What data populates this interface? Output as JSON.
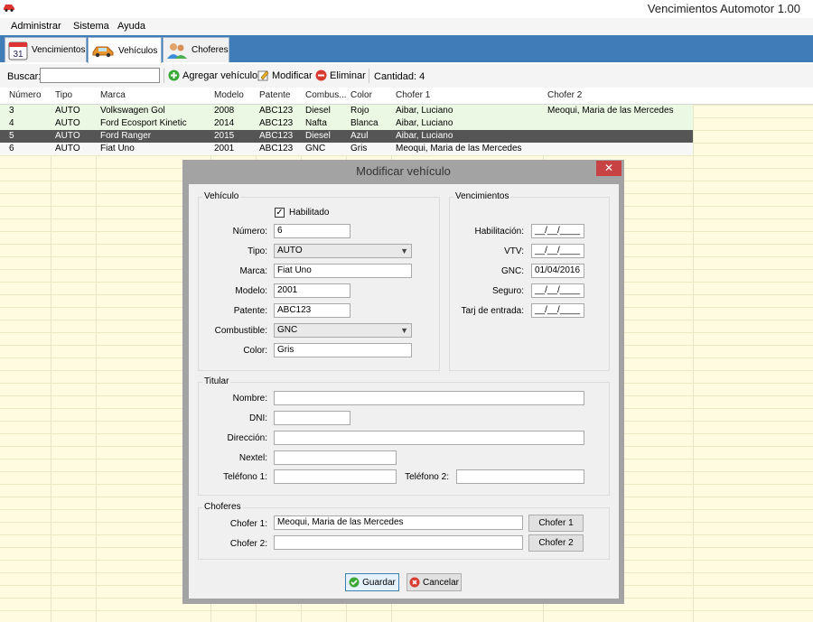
{
  "window": {
    "title": "Vencimientos Automotor 1.00"
  },
  "menu": [
    "Administrar",
    "Sistema",
    "Ayuda"
  ],
  "tabs": [
    {
      "label": "Vencimientos",
      "icon": "calendar-icon",
      "badge": "31"
    },
    {
      "label": "Vehículos",
      "icon": "car-icon"
    },
    {
      "label": "Choferes",
      "icon": "users-icon"
    }
  ],
  "toolbar": {
    "search_label": "Buscar:",
    "search_value": "",
    "add_label": "Agregar vehículo",
    "edit_label": "Modificar",
    "delete_label": "Eliminar",
    "count_label": "Cantidad: 4"
  },
  "grid": {
    "columns": [
      "Número",
      "Tipo",
      "Marca",
      "Modelo",
      "Patente",
      "Combus...",
      "Color",
      "Chofer 1",
      "Chofer 2"
    ],
    "rows": [
      [
        "3",
        "AUTO",
        "Volkswagen Gol",
        "2008",
        "ABC123",
        "Diesel",
        "Rojo",
        "Aibar, Luciano",
        "Meoqui, Maria de las Mercedes"
      ],
      [
        "4",
        "AUTO",
        "Ford Ecosport Kinetic",
        "2014",
        "ABC123",
        "Nafta",
        "Blanca",
        "Aibar, Luciano",
        ""
      ],
      [
        "5",
        "AUTO",
        "Ford Ranger",
        "2015",
        "ABC123",
        "Diesel",
        "Azul",
        "Aibar, Luciano",
        ""
      ],
      [
        "6",
        "AUTO",
        "Fiat Uno",
        "2001",
        "ABC123",
        "GNC",
        "Gris",
        "Meoqui, Maria de las Mercedes",
        ""
      ]
    ],
    "selected_row": 2
  },
  "dialog": {
    "title": "Modificar vehículo",
    "close": "✕",
    "vehiculo": {
      "title": "Vehículo",
      "habilitado_label": "Habilitado",
      "habilitado": true,
      "numero_label": "Número:",
      "numero": "6",
      "tipo_label": "Tipo:",
      "tipo": "AUTO",
      "marca_label": "Marca:",
      "marca": "Fiat Uno",
      "modelo_label": "Modelo:",
      "modelo": "2001",
      "patente_label": "Patente:",
      "patente": "ABC123",
      "combustible_label": "Combustible:",
      "combustible": "GNC",
      "color_label": "Color:",
      "color": "Gris"
    },
    "vencimientos": {
      "title": "Vencimientos",
      "habilitacion_label": "Habilitación:",
      "habilitacion": "__/__/____",
      "vtv_label": "VTV:",
      "vtv": "__/__/____",
      "gnc_label": "GNC:",
      "gnc": "01/04/2016",
      "seguro_label": "Seguro:",
      "seguro": "__/__/____",
      "tarjeta_label": "Tarj de entrada:",
      "tarjeta": "__/__/____"
    },
    "titular": {
      "title": "Titular",
      "nombre_label": "Nombre:",
      "nombre": "",
      "dni_label": "DNI:",
      "dni": "",
      "direccion_label": "Dirección:",
      "direccion": "",
      "nextel_label": "Nextel:",
      "nextel": "",
      "telefono1_label": "Teléfono 1:",
      "telefono1": "",
      "telefono2_label": "Teléfono 2:",
      "telefono2": ""
    },
    "choferes": {
      "title": "Choferes",
      "chofer1_label": "Chofer 1:",
      "chofer1": "Meoqui, Maria de las Mercedes",
      "chofer1_btn": "Chofer 1",
      "chofer2_label": "Chofer 2:",
      "chofer2": "",
      "chofer2_btn": "Chofer 2"
    },
    "guardar": "Guardar",
    "cancelar": "Cancelar"
  },
  "colors": {
    "ribbon": "#3f7cb8",
    "grid_bg": "#fffbe0",
    "row_green": "#ebf9e4",
    "row_selected": "#555555",
    "close": "#c74343"
  }
}
